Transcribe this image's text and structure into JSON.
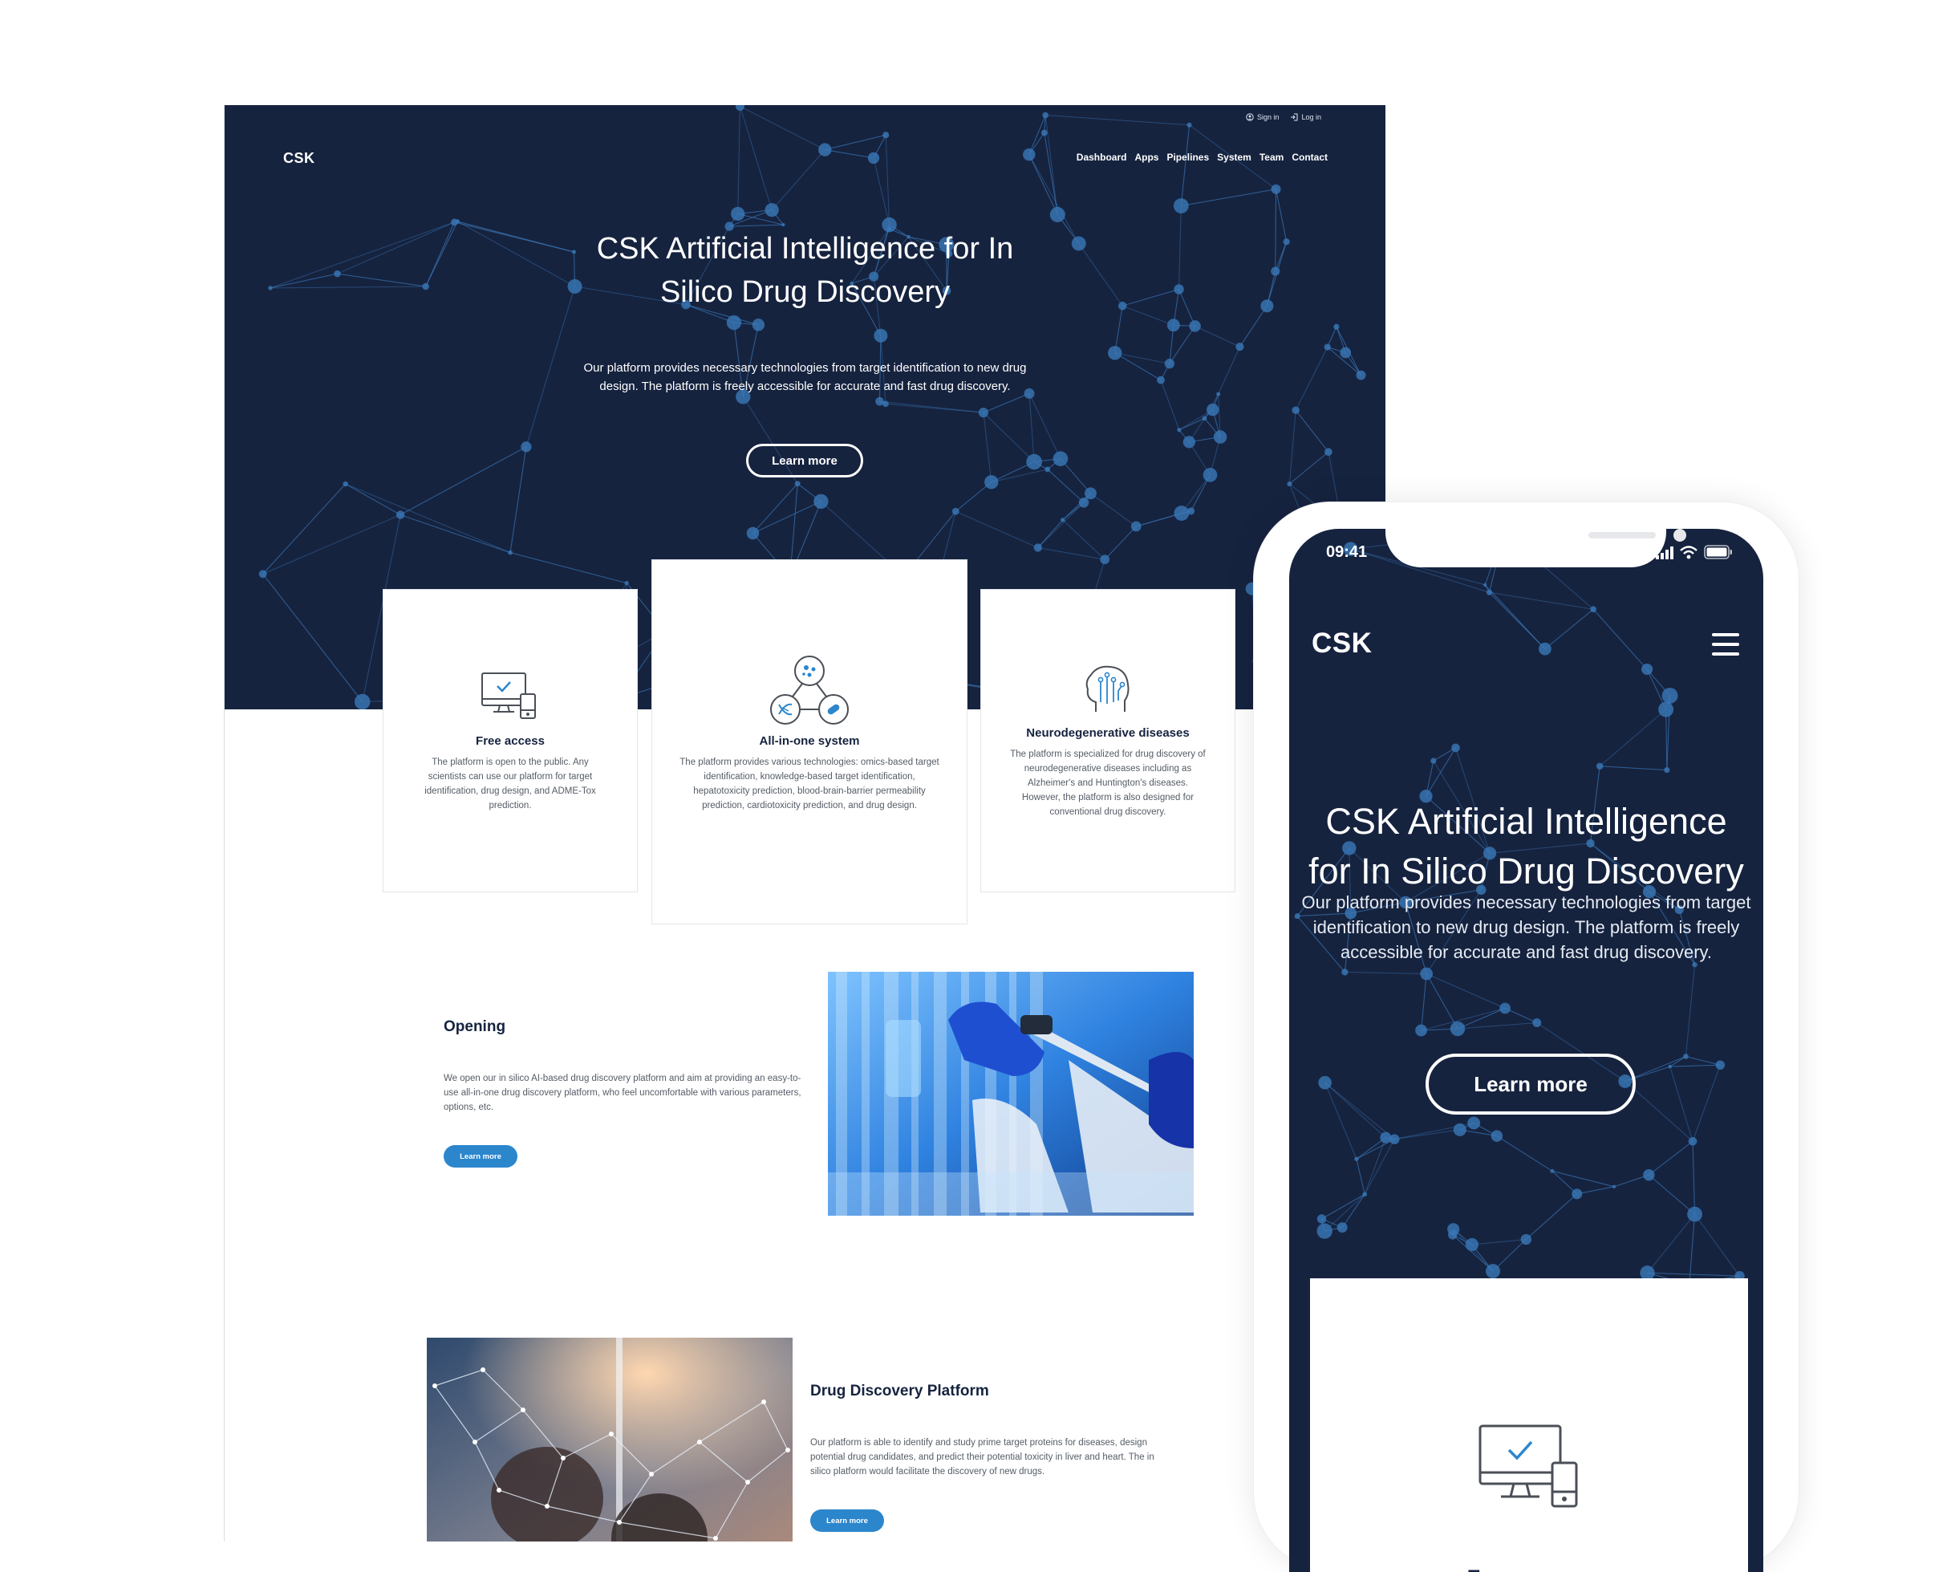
{
  "desktop": {
    "logo": "CSK",
    "account": {
      "sign_in": "Sign in",
      "log_in": "Log in"
    },
    "nav": [
      "Dashboard",
      "Apps",
      "Pipelines",
      "System",
      "Team",
      "Contact"
    ],
    "hero": {
      "title_line1": "CSK Artificial Intelligence for In",
      "title_line2": "Silico Drug Discovery",
      "subtitle_line1": "Our platform provides necessary technologies from target identification to new drug",
      "subtitle_line2": "design. The platform is freely accessible for accurate and fast drug discovery.",
      "cta": "Learn more"
    },
    "cards": [
      {
        "title": "Free access",
        "text": "The platform is open to the public. Any scientists can use our platform for target identification, drug design, and ADME-Tox prediction.",
        "icon": "monitor-check-icon"
      },
      {
        "title": "All-in-one system",
        "text": "The platform provides various technologies: omics-based target identification, knowledge-based target identification, hepatotoxicity prediction, blood-brain-barrier permeability prediction, cardiotoxicity prediction, and drug design.",
        "icon": "molecule-network-icon"
      },
      {
        "title": "Neurodegenerative diseases",
        "text": "The platform is specialized for drug discovery of neurodegenerative diseases including as Alzheimer's and Huntington's diseases. However, the platform is also designed for conventional drug discovery.",
        "icon": "brain-circuit-icon"
      }
    ],
    "sections": [
      {
        "title": "Opening",
        "text": "We open our in silico AI-based drug discovery platform and aim at providing an easy-to-use all-in-one drug discovery platform, who feel uncomfortable with various parameters, options, etc.",
        "cta": "Learn more"
      },
      {
        "title": "Drug Discovery Platform",
        "text": "Our platform is able to identify and study prime target proteins for diseases, design potential drug candidates, and predict their potential toxicity in liver and heart. The in silico platform would facilitate the discovery of new drugs.",
        "cta": "Learn more"
      }
    ]
  },
  "mobile": {
    "time": "09:41",
    "logo": "CSK",
    "hero": {
      "title_line1": "CSK Artificial Intelligence",
      "title_line2": "for In Silico Drug Discovery",
      "subtitle_line1": "Our platform provides necessary technologies from target",
      "subtitle_line2": "identification to new drug design. The platform is freely",
      "subtitle_line3": "accessible for accurate and fast drug discovery.",
      "cta": "Learn more"
    },
    "card": {
      "title": "Free access"
    }
  },
  "colors": {
    "navy": "#16233f",
    "accent_blue": "#2c86cc",
    "network_node": "#3a78b8",
    "text_gray": "#555c66"
  }
}
